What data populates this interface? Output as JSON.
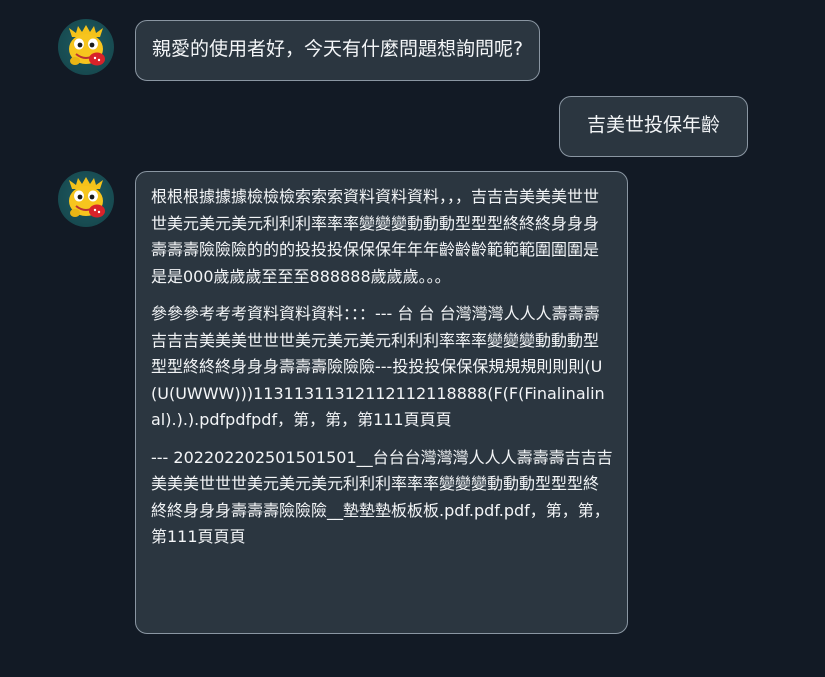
{
  "messages": [
    {
      "role": "assistant",
      "text": "親愛的使用者好，今天有什麼問題想詢問呢?"
    },
    {
      "role": "user",
      "text": "吉美世投保年齡"
    },
    {
      "role": "assistant",
      "paragraphs": [
        "根根根據據據檢檢檢索索索資料資料資料，，，吉吉吉美美美世世世美元美元美元利利利率率率變變變動動動型型型終終終身身身壽壽壽險險險的的的投投投保保保年年年齡齡齡範範範圍圍圍是是是000歲歲歲至至至888888歲歲歲。。。",
        "參參參考考考資料資料資料：：：--- 台 台 台灣灣灣人人人壽壽壽吉吉吉美美美世世世美元美元美元利利利率率率變變變動動動型型型終終終身身身壽壽壽險險險---投投投保保保規規規則則則(U(U(UWWW)))11311311312112112118888(F(F(Finalinalinal).).).pdfpdfpdf，第，第，第111頁頁頁",
        "--- 202202202501501501__台台台灣灣灣人人人壽壽壽吉吉吉美美美世世世美元美元美元利利利率率率變變變動動動型型型終終終身身身壽壽壽險險險__墊墊墊板板板.pdf.pdf.pdf，第，第，第111頁頁頁"
      ]
    }
  ],
  "colors": {
    "background": "#121a25",
    "bubble": "#2b3640",
    "bubble_border": "#8a96a2",
    "text": "#f3f5f7"
  },
  "icons": {
    "assistant_avatar": "mascot-avatar-icon"
  }
}
